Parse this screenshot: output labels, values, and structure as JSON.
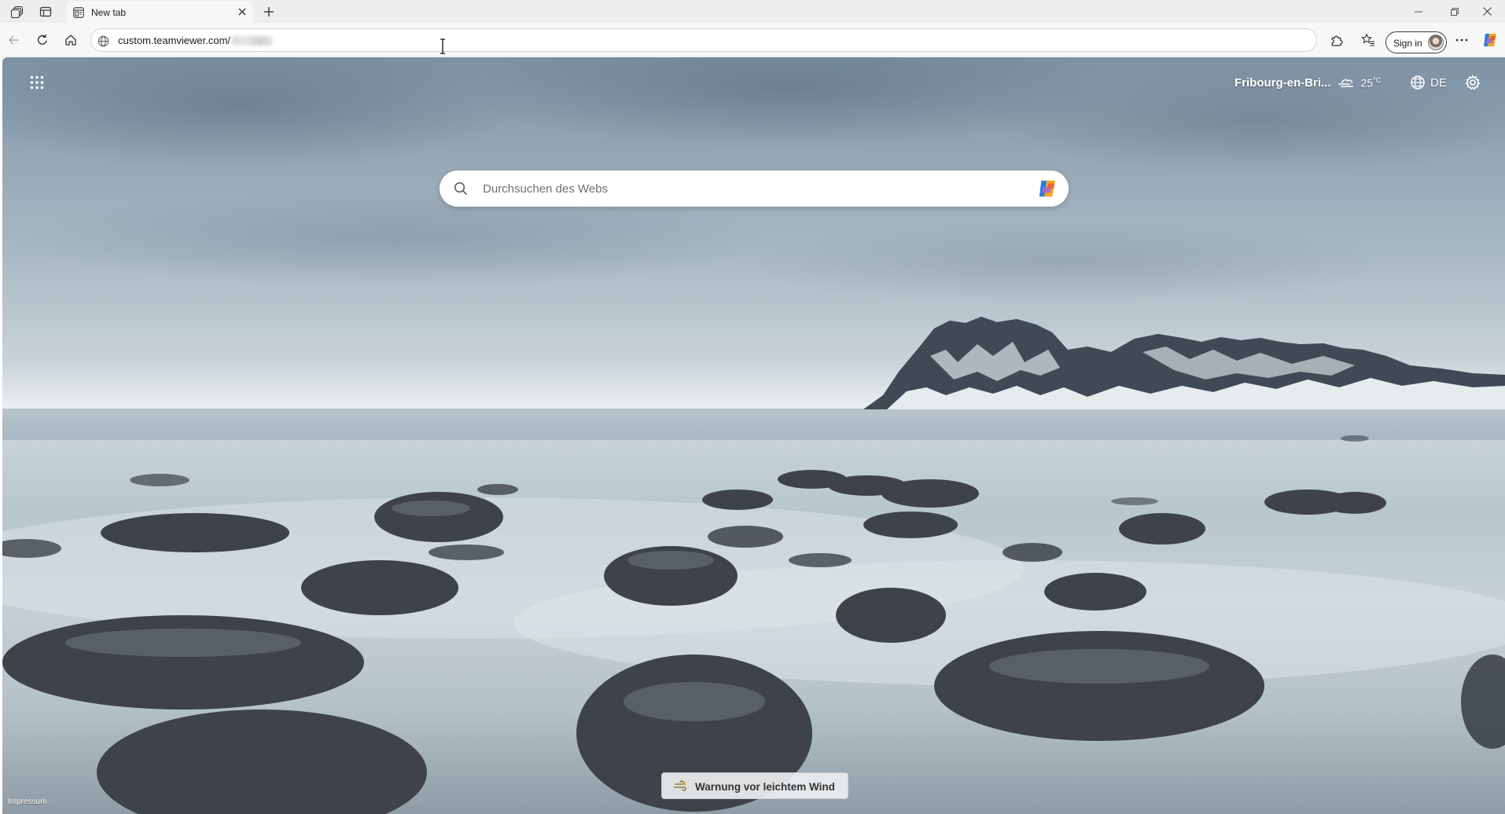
{
  "tab": {
    "title": "New tab"
  },
  "address_bar": {
    "url": "custom.teamviewer.com/"
  },
  "toolbar": {
    "sign_in_label": "Sign in"
  },
  "new_tab_page": {
    "weather": {
      "location": "Fribourg-en-Bri...",
      "temperature": "25",
      "unit": "°C",
      "icon": "wind-cloud-icon"
    },
    "language": "DE",
    "search": {
      "placeholder": "Durchsuchen des Webs"
    },
    "alert": {
      "text": "Warnung vor leichtem Wind",
      "icon": "wind-warning-icon"
    },
    "footer": {
      "impressum": "Impressum"
    }
  },
  "colors": {
    "tabstrip_bg": "#eeeeee",
    "toolbar_bg": "#f7f7f7",
    "text": "#1b1b1b"
  }
}
